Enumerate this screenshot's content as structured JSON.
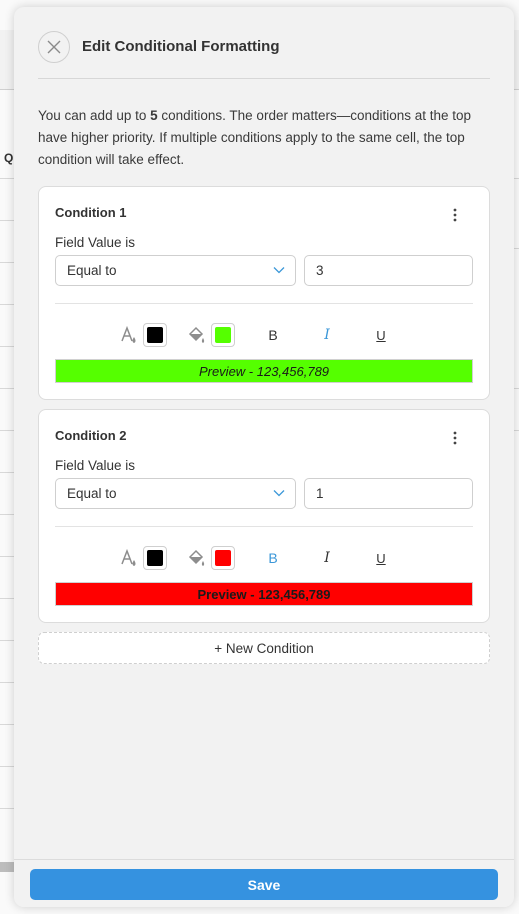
{
  "dialog": {
    "title": "Edit Conditional Formatting",
    "description_pre": "You can add up to ",
    "description_bold": "5",
    "description_post": " conditions. The order matters—conditions at the top have higher priority. If multiple conditions apply to the same cell, the top condition will take effect."
  },
  "background": {
    "column_letter": "Q"
  },
  "conditions": [
    {
      "title": "Condition 1",
      "field_label": "Field Value is",
      "operator": "Equal to",
      "value": "3",
      "font_color": "#000000",
      "fill_color": "#55ff00",
      "bold": false,
      "italic": true,
      "underline": false,
      "preview_text": "Preview - 123,456,789"
    },
    {
      "title": "Condition 2",
      "field_label": "Field Value is",
      "operator": "Equal to",
      "value": "1",
      "font_color": "#000000",
      "fill_color": "#ff0000",
      "bold": true,
      "italic": false,
      "underline": false,
      "preview_text": "Preview - 123,456,789"
    }
  ],
  "toolbar": {
    "bold_label": "B",
    "italic_label": "I",
    "underline_label": "U"
  },
  "new_condition_label": "+ New Condition",
  "save_label": "Save",
  "colors": {
    "accent": "#3592e0",
    "active_format": "#3b97d8"
  }
}
